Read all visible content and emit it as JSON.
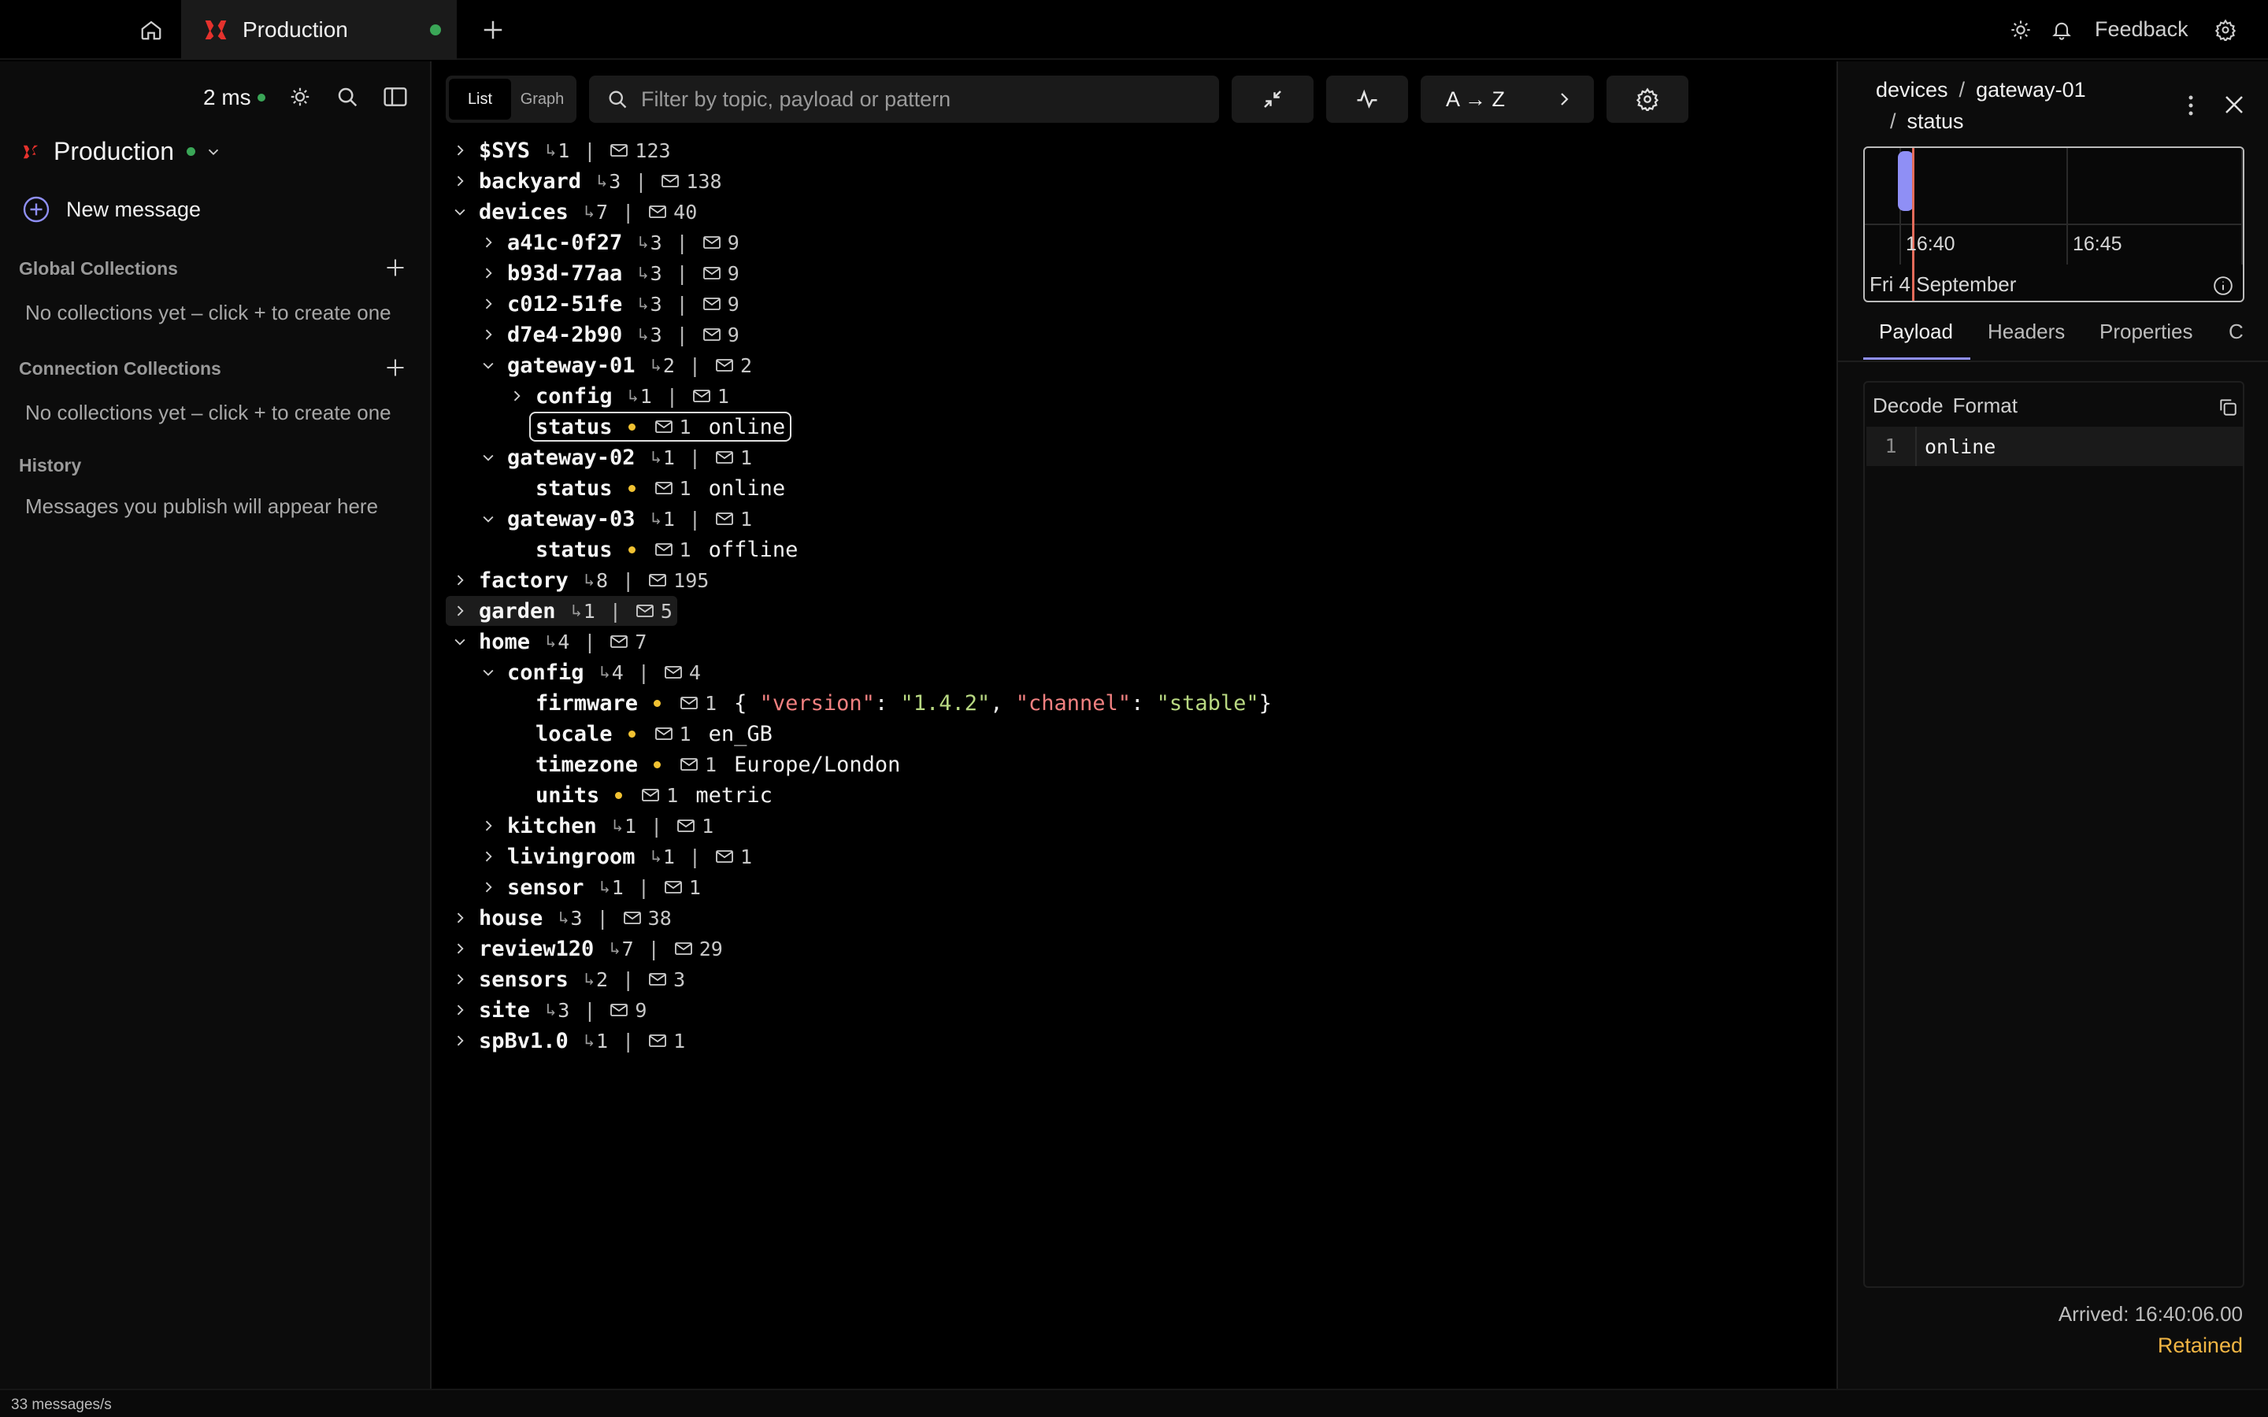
{
  "topbar": {
    "tab_title": "Production",
    "feedback_label": "Feedback",
    "accent": "#e5322d",
    "status_color": "#3aa657"
  },
  "sidebar": {
    "latency": "2 ms",
    "connection_name": "Production",
    "new_message_label": "New message",
    "global_collections": {
      "title": "Global Collections",
      "empty": "No collections yet – click + to create one"
    },
    "connection_collections": {
      "title": "Connection Collections",
      "empty": "No collections yet – click + to create one"
    },
    "history": {
      "title": "History",
      "empty": "Messages you publish will appear here"
    }
  },
  "toolbar": {
    "view_list": "List",
    "view_graph": "Graph",
    "filter_placeholder": "Filter by topic, payload or pattern",
    "sort_label": "A → Z"
  },
  "tree": {
    "rows": [
      {
        "name": "$SYS",
        "subs": "1",
        "msgs": "123"
      },
      {
        "name": "backyard",
        "subs": "3",
        "msgs": "138"
      },
      {
        "name": "devices",
        "subs": "7",
        "msgs": "40"
      },
      {
        "name": "a41c-0f27",
        "subs": "3",
        "msgs": "9"
      },
      {
        "name": "b93d-77aa",
        "subs": "3",
        "msgs": "9"
      },
      {
        "name": "c012-51fe",
        "subs": "3",
        "msgs": "9"
      },
      {
        "name": "d7e4-2b90",
        "subs": "3",
        "msgs": "9"
      },
      {
        "name": "gateway-01",
        "subs": "2",
        "msgs": "2"
      },
      {
        "name": "config",
        "subs": "1",
        "msgs": "1"
      },
      {
        "name": "status",
        "msgs": "1",
        "value": "online"
      },
      {
        "name": "gateway-02",
        "subs": "1",
        "msgs": "1"
      },
      {
        "name": "status",
        "msgs": "1",
        "value": "online"
      },
      {
        "name": "gateway-03",
        "subs": "1",
        "msgs": "1"
      },
      {
        "name": "status",
        "msgs": "1",
        "value": "offline"
      },
      {
        "name": "factory",
        "subs": "8",
        "msgs": "195"
      },
      {
        "name": "garden",
        "subs": "1",
        "msgs": "5"
      },
      {
        "name": "home",
        "subs": "4",
        "msgs": "7"
      },
      {
        "name": "config",
        "subs": "4",
        "msgs": "4"
      },
      {
        "name": "firmware",
        "msgs": "1",
        "json": {
          "k1": "\"version\"",
          "v1": "\"1.4.2\"",
          "k2": "\"channel\"",
          "v2": "\"stable\""
        }
      },
      {
        "name": "locale",
        "msgs": "1",
        "value": "en_GB"
      },
      {
        "name": "timezone",
        "msgs": "1",
        "value": "Europe/London"
      },
      {
        "name": "units",
        "msgs": "1",
        "value": "metric"
      },
      {
        "name": "kitchen",
        "subs": "1",
        "msgs": "1"
      },
      {
        "name": "livingroom",
        "subs": "1",
        "msgs": "1"
      },
      {
        "name": "sensor",
        "subs": "1",
        "msgs": "1"
      },
      {
        "name": "house",
        "subs": "3",
        "msgs": "38"
      },
      {
        "name": "review120",
        "subs": "7",
        "msgs": "29"
      },
      {
        "name": "sensors",
        "subs": "2",
        "msgs": "3"
      },
      {
        "name": "site",
        "subs": "3",
        "msgs": "9"
      },
      {
        "name": "spBv1.0",
        "subs": "1",
        "msgs": "1"
      }
    ]
  },
  "detail": {
    "crumb": [
      "devices",
      "gateway-01",
      "status"
    ],
    "crumb_sep": "/",
    "timeline": {
      "tick1": "16:40",
      "tick2": "16:45",
      "date": "Fri 4 September"
    },
    "tabs": [
      "Payload",
      "Headers",
      "Properties",
      "C"
    ],
    "decode_label": "Decode",
    "format_label": "Format",
    "line_number": "1",
    "payload": "online",
    "arrived": "Arrived: 16:40:06.00",
    "retained": "Retained"
  },
  "statusbar": {
    "rate": "33 messages/s"
  }
}
